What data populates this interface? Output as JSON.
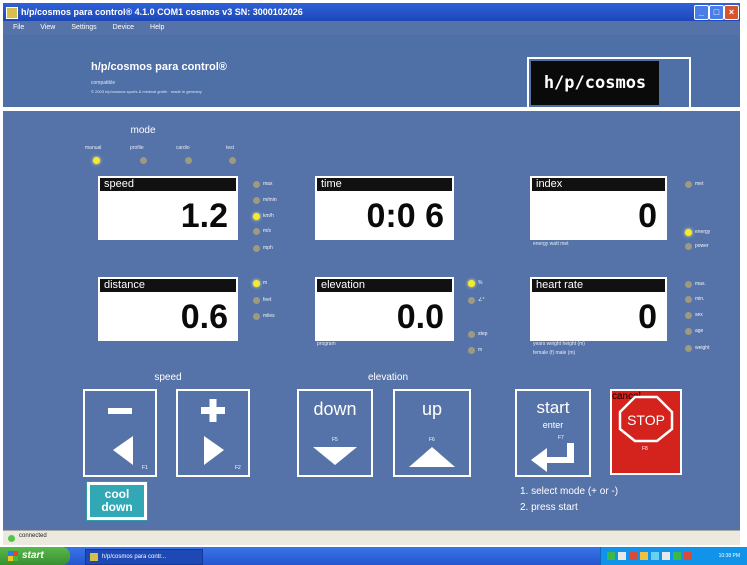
{
  "window": {
    "title": "h/p/cosmos para control® 4.1.0  COM1 cosmos v3  SN: 3000102026"
  },
  "menu": [
    "File",
    "View",
    "Settings",
    "Device",
    "Help"
  ],
  "brand": {
    "title": "h/p/cosmos para control®",
    "subtitle": "compatible",
    "copyright": "© 2003 h/p/cosmos sports & medical gmbh · made in germany",
    "logo": "h/p/cosmos"
  },
  "mode": {
    "title": "mode",
    "options": [
      {
        "label": "manual",
        "active": true
      },
      {
        "label": "profile",
        "active": false
      },
      {
        "label": "cardio",
        "active": false
      },
      {
        "label": "test",
        "active": false
      }
    ]
  },
  "speed": {
    "label": "speed",
    "value": "1.2",
    "units": [
      {
        "label": "max",
        "active": false
      },
      {
        "label": "m/min",
        "active": false
      },
      {
        "label": "km/h",
        "active": true
      },
      {
        "label": "m/s",
        "active": false
      },
      {
        "label": "mph",
        "active": false
      }
    ]
  },
  "time": {
    "label": "time",
    "value": "0:0 6"
  },
  "index": {
    "label": "index",
    "value": "0",
    "footer": "energy   watt   met",
    "units": [
      {
        "label": "met",
        "active": false
      },
      {
        "label": "energy",
        "active": true
      },
      {
        "label": "power",
        "active": false
      }
    ]
  },
  "distance": {
    "label": "distance",
    "value": "0.6",
    "units": [
      {
        "label": "m",
        "active": true
      },
      {
        "label": "feet",
        "active": false
      },
      {
        "label": "miles",
        "active": false
      }
    ]
  },
  "elevation": {
    "label": "elevation",
    "value": "0.0",
    "footer": "program",
    "units": [
      {
        "label": "%",
        "active": true
      },
      {
        "label": "∠°",
        "active": false
      },
      {
        "label": "step",
        "active": false
      },
      {
        "label": "m",
        "active": false
      }
    ]
  },
  "heart_rate": {
    "label": "heart rate",
    "value": "0",
    "footer": "years   weight   height (m)",
    "footer2": "female (f)   male (m)",
    "units": [
      {
        "label": "max.",
        "active": false
      },
      {
        "label": "min.",
        "active": false
      },
      {
        "label": "sex",
        "active": false
      },
      {
        "label": "age",
        "active": false
      },
      {
        "label": "weight",
        "active": false
      }
    ]
  },
  "controls": {
    "speed_title": "speed",
    "elevation_title": "elevation",
    "speed_minus_key": "F1",
    "speed_plus_key": "F2",
    "down_label": "down",
    "down_key": "F5",
    "up_label": "up",
    "up_key": "F6",
    "start_label": "start",
    "start_sub": "enter",
    "start_key": "F7",
    "stop_label": "STOP",
    "stop_key": "F8",
    "cancel_label": "cancel",
    "cooldown_label": "cool down"
  },
  "instructions": [
    "1. select mode (+ or -)",
    "2. press start"
  ],
  "status": {
    "text": "connected"
  },
  "taskbar": {
    "start": "start",
    "item": "h/p/cosmos para contr...",
    "clock": "10:38 PM"
  },
  "colors": {
    "panel_bg": "#5573a8",
    "led_on": "#f6ea2c",
    "led_off": "#9d9a80",
    "stop": "#d4221c",
    "cooldown": "#32a8b4"
  }
}
